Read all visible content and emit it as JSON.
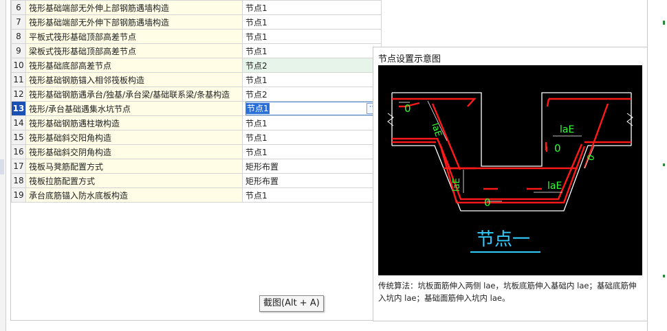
{
  "table": {
    "rows": [
      {
        "num": "6",
        "name": "筏形基础端部无外伸上部钢筋遇墙构造",
        "value": "节点1"
      },
      {
        "num": "7",
        "name": "筏形基础端部无外伸下部钢筋遇墙构造",
        "value": "节点1"
      },
      {
        "num": "8",
        "name": "平板式筏形基础顶部高差节点",
        "value": "节点1"
      },
      {
        "num": "9",
        "name": "梁板式筏形基础顶部高差节点",
        "value": "节点1"
      },
      {
        "num": "10",
        "name": "筏形基础底部高差节点",
        "value": "节点2"
      },
      {
        "num": "11",
        "name": "筏形基础钢筋锚入相邻筏板构造",
        "value": "节点1"
      },
      {
        "num": "12",
        "name": "筏形基础钢筋遇承台/独基/承台梁/基础联系梁/条基构造",
        "value": "节点2"
      },
      {
        "num": "13",
        "name": "筏形/承台基础遇集水坑节点",
        "value": "节点1"
      },
      {
        "num": "14",
        "name": "筏形基础钢筋遇柱墩构造",
        "value": "节点1"
      },
      {
        "num": "15",
        "name": "筏形基础斜交阳角构造",
        "value": "节点1"
      },
      {
        "num": "16",
        "name": "筏形基础斜交阴角构造",
        "value": "节点1"
      },
      {
        "num": "17",
        "name": "筏板马凳筋配置方式",
        "value": "矩形布置"
      },
      {
        "num": "18",
        "name": "筏板拉筋配置方式",
        "value": "矩形布置"
      },
      {
        "num": "19",
        "name": "承台底筋锚入防水底板构造",
        "value": "节点1"
      }
    ],
    "selected_row": "13",
    "highlighted_row": "10"
  },
  "preview": {
    "title": "节点设置示意图",
    "diagram": {
      "title": "节点一",
      "labels": {
        "lae_left": "laE",
        "lae_top_right": "laE",
        "lae_mid_left": "laE",
        "lae_mid_right": "laE",
        "lae_right_slope": "laE"
      },
      "zeros": [
        "0",
        "0",
        "0",
        "0"
      ],
      "colors": {
        "background": "#000000",
        "rebar": "#ff1a1a",
        "outline": "#ffffff",
        "dimension": "#33ff33",
        "title": "#33ccff"
      }
    },
    "description": "传统算法：坑板面筋伸入两侧 lae，坑板底筋伸入基础内 lae；基础底筋伸入坑内 lae；基础面筋伸入坑内 lae。"
  },
  "tooltip": "截图(Alt + A)",
  "edit_button_icon": "ellipsis-icon",
  "colors": {
    "name_column_bg": "#fffde6",
    "selected_row_bg": "#1a4fb3",
    "highlight_row_bg": "#e6f4ea"
  }
}
